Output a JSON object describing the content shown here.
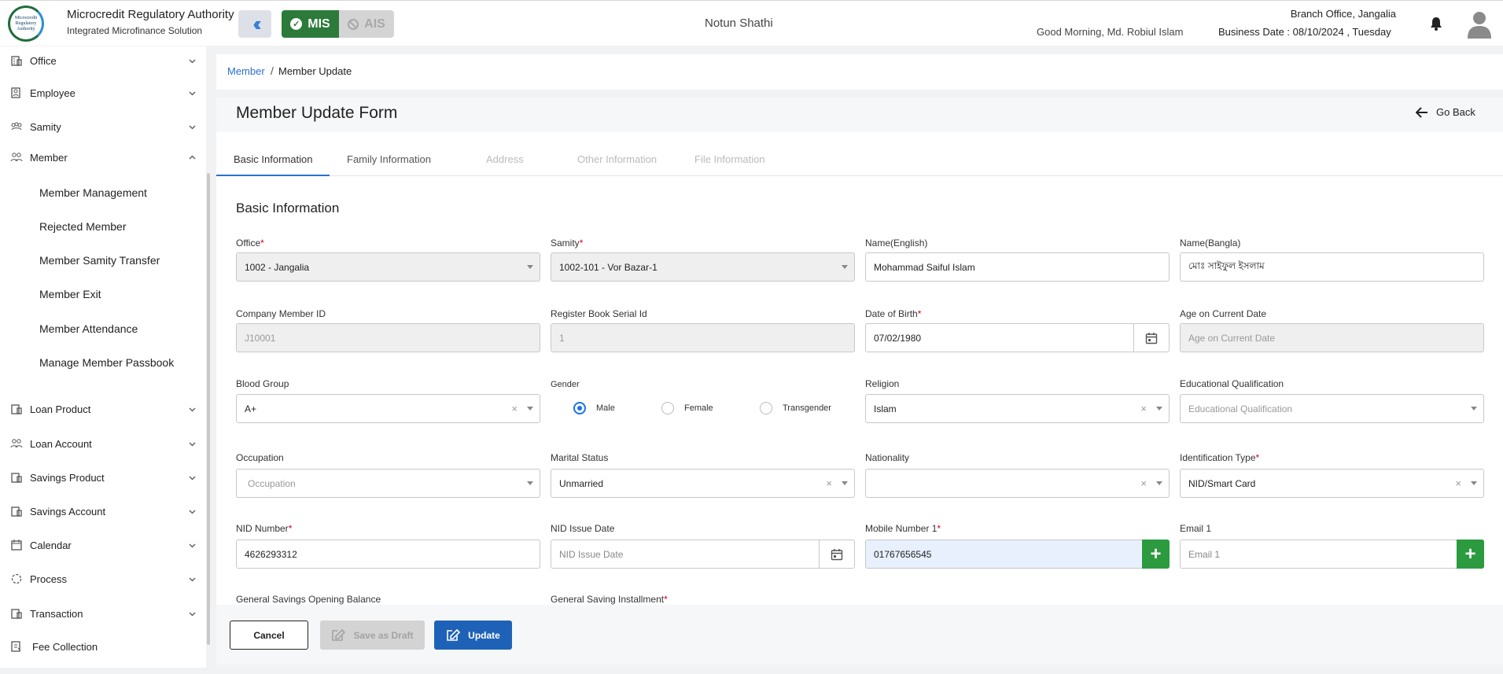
{
  "header": {
    "org_title": "Microcredit Regulatory Authority",
    "org_subtitle": "Integrated Microfinance Solution",
    "logo_text": "Microcredit Regulatory Authority",
    "mis_label": "MIS",
    "ais_label": "AIS",
    "app_name": "Notun Shathi",
    "greeting": "Good Morning, Md. Robiul Islam",
    "branch": "Branch Office, Jangalia",
    "business_date": "Business Date : 08/10/2024 , Tuesday"
  },
  "sidebar": {
    "items": [
      {
        "label": "Office",
        "icon": "office-icon"
      },
      {
        "label": "Employee",
        "icon": "employee-icon"
      },
      {
        "label": "Samity",
        "icon": "samity-icon"
      },
      {
        "label": "Member",
        "icon": "member-icon"
      },
      {
        "label": "Loan Product",
        "icon": "loan-product-icon"
      },
      {
        "label": "Loan Account",
        "icon": "loan-account-icon"
      },
      {
        "label": "Savings Product",
        "icon": "savings-product-icon"
      },
      {
        "label": "Savings Account",
        "icon": "savings-account-icon"
      },
      {
        "label": "Calendar",
        "icon": "calendar-icon"
      },
      {
        "label": "Process",
        "icon": "process-icon"
      },
      {
        "label": "Transaction",
        "icon": "transaction-icon"
      },
      {
        "label": "Fee Collection",
        "icon": "fee-collection-icon"
      }
    ],
    "member_sub": [
      "Member Management",
      "Rejected Member",
      "Member Samity Transfer",
      "Member Exit",
      "Member Attendance",
      "Manage Member Passbook"
    ]
  },
  "breadcrumb": {
    "parent": "Member",
    "separator": "/",
    "current": "Member Update"
  },
  "form": {
    "title": "Member Update Form",
    "go_back": "Go Back",
    "tabs": [
      "Basic Information",
      "Family Information",
      "Address",
      "Other Information",
      "File Information"
    ],
    "section_title": "Basic Information",
    "fields": {
      "office": {
        "label": "Office",
        "value": "1002 - Jangalia"
      },
      "samity": {
        "label": "Samity",
        "value": "1002-101 - Vor Bazar-1"
      },
      "name_en": {
        "label": "Name(English)",
        "value": "Mohammad Saiful Islam"
      },
      "name_bn": {
        "label": "Name(Bangla)",
        "value": "মোঃ সাইফুল ইসলাম"
      },
      "company_member_id": {
        "label": "Company Member ID",
        "value": "J10001"
      },
      "register_serial": {
        "label": "Register Book Serial Id",
        "value": "1"
      },
      "dob": {
        "label": "Date of Birth",
        "value": "07/02/1980"
      },
      "age": {
        "label": "Age on Current Date",
        "placeholder": "Age on Current Date"
      },
      "blood_group": {
        "label": "Blood Group",
        "value": "A+"
      },
      "gender": {
        "label": "Gender",
        "options": [
          "Male",
          "Female",
          "Transgender"
        ],
        "selected": "Male"
      },
      "religion": {
        "label": "Religion",
        "value": "Islam"
      },
      "education": {
        "label": "Educational Qualification",
        "placeholder": "Educational Qualification"
      },
      "occupation": {
        "label": "Occupation",
        "placeholder": "Occupation"
      },
      "marital": {
        "label": "Marital Status",
        "value": "Unmarried"
      },
      "nationality": {
        "label": "Nationality",
        "value": ""
      },
      "id_type": {
        "label": "Identification Type",
        "value": "NID/Smart Card"
      },
      "nid_number": {
        "label": "NID Number",
        "value": "4626293312"
      },
      "nid_issue": {
        "label": "NID Issue Date",
        "placeholder": "NID Issue Date"
      },
      "mobile1": {
        "label": "Mobile Number 1",
        "value": "01767656545"
      },
      "email1": {
        "label": "Email 1",
        "placeholder": "Email 1"
      },
      "gs_opening": {
        "label": "General Savings Opening Balance"
      },
      "gs_installment": {
        "label": "General Saving Installment"
      }
    },
    "required_mark": "*",
    "clear_mark": "×"
  },
  "buttons": {
    "cancel": "Cancel",
    "draft": "Save as Draft",
    "update": "Update"
  },
  "colors": {
    "accent": "#1e62b8",
    "mis_green": "#2c7a3a",
    "add_green": "#2c9a3f"
  }
}
